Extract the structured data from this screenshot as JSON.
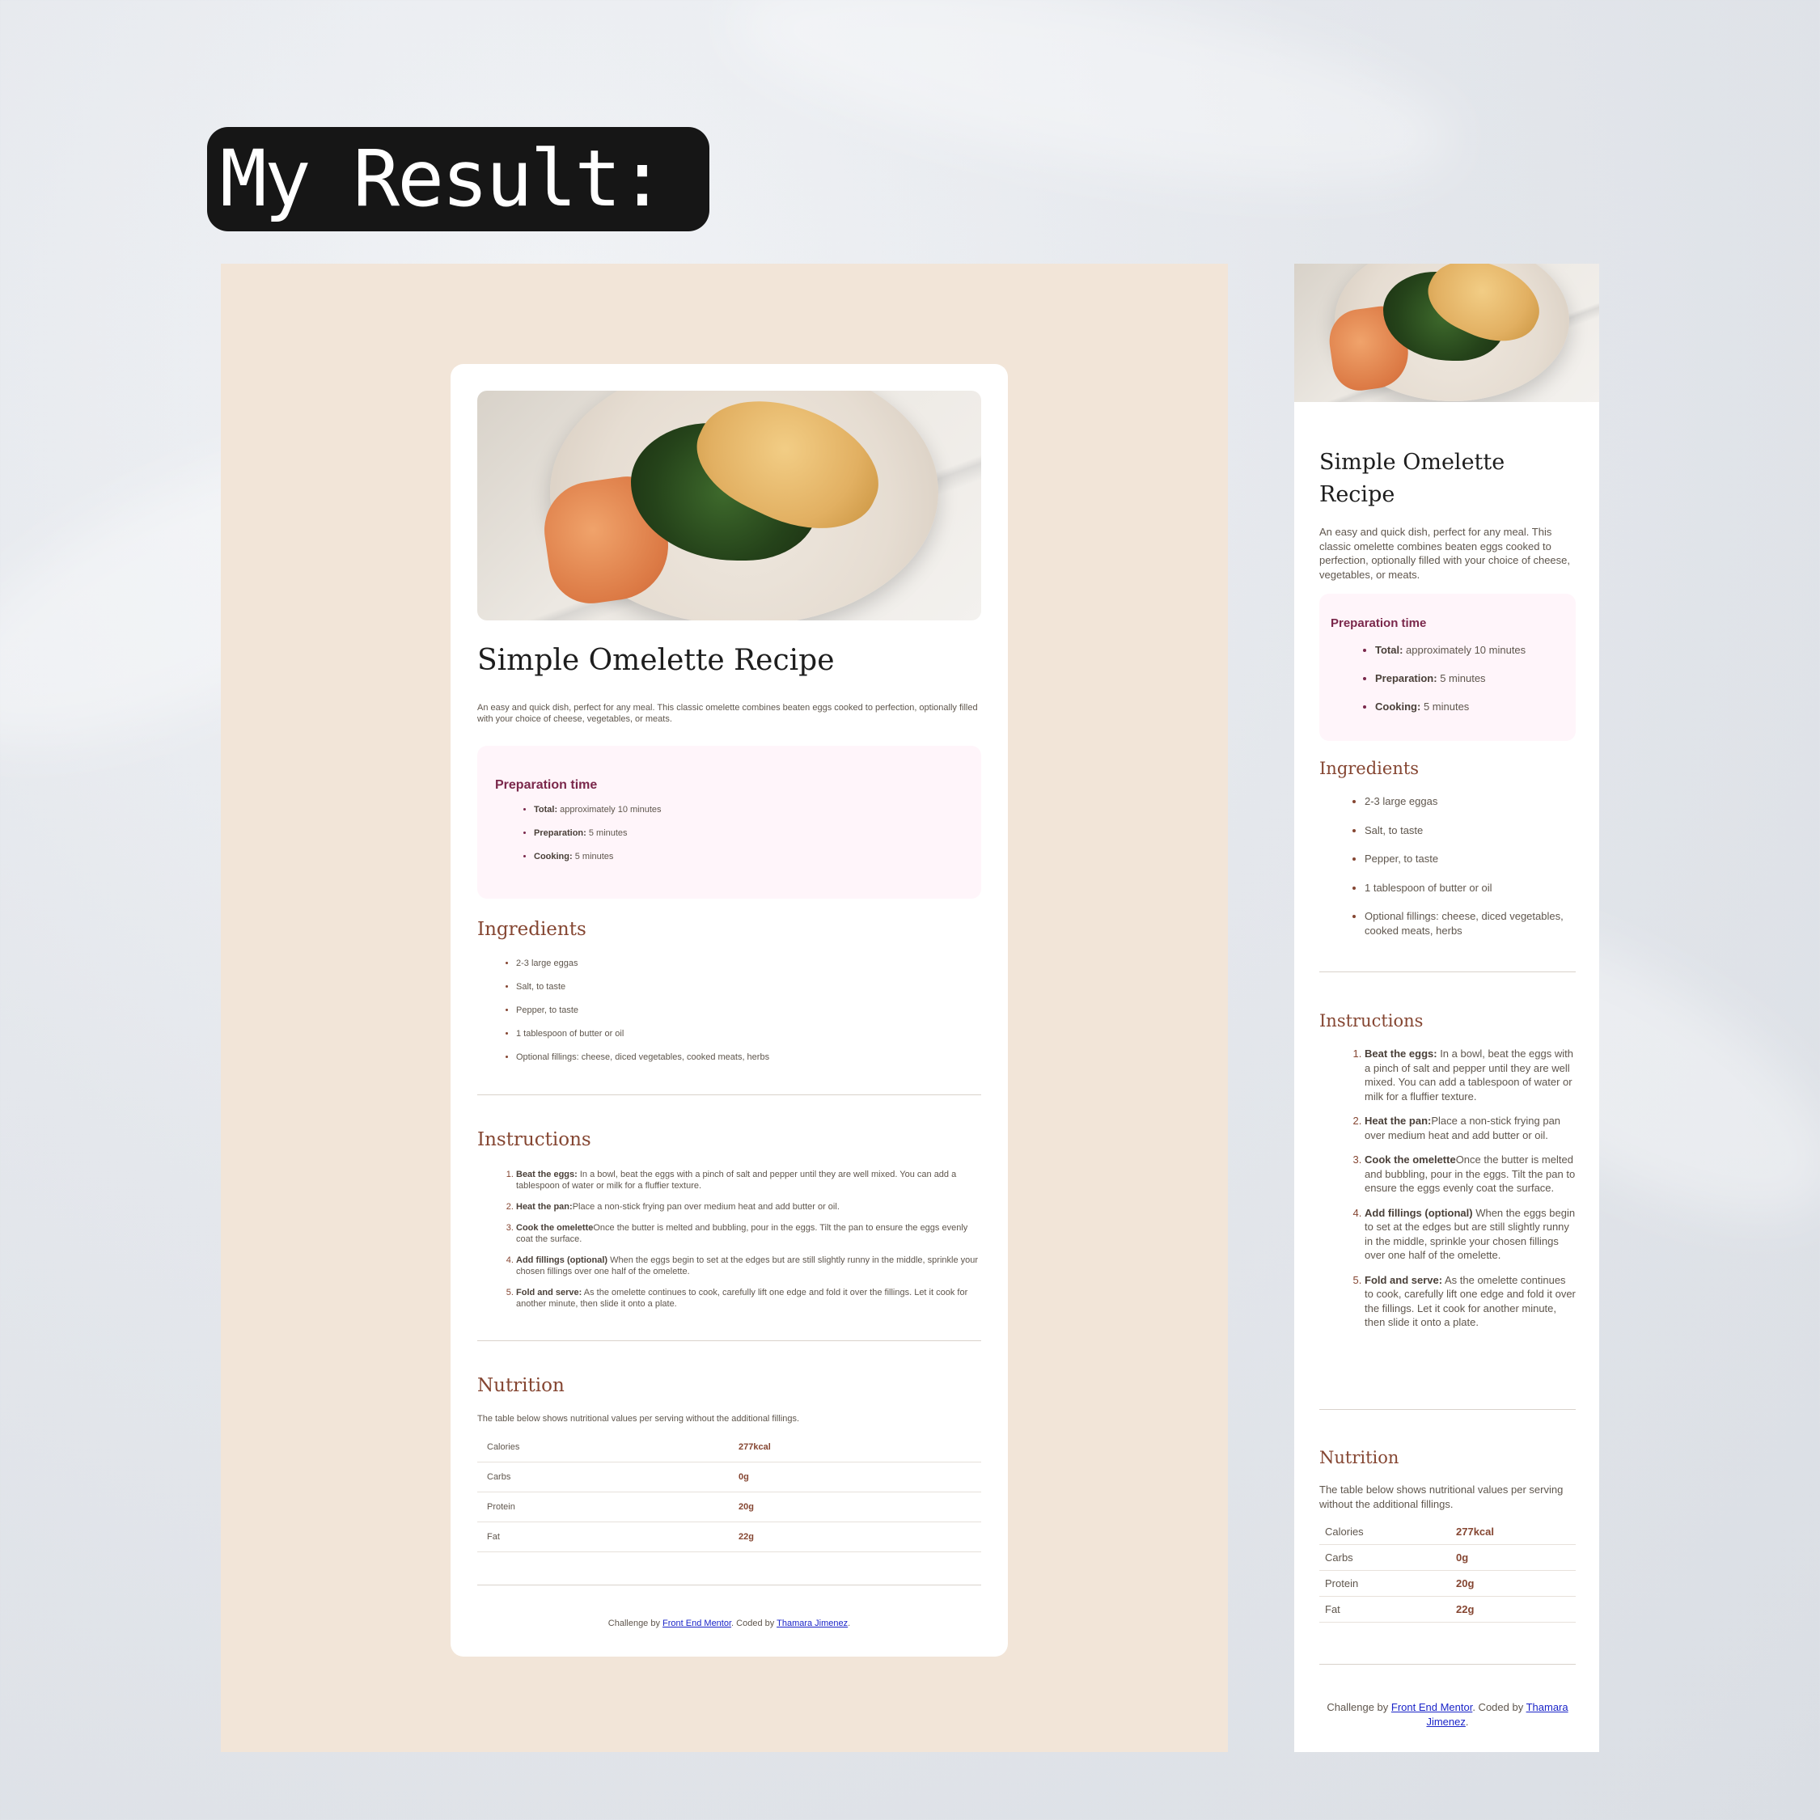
{
  "badge": "My Result:",
  "recipe": {
    "title": "Simple Omelette Recipe",
    "intro": "An easy and quick dish, perfect for any meal. This classic omelette combines beaten eggs cooked to perfection, optionally filled with your choice of cheese, vegetables, or meats.",
    "prep": {
      "heading": "Preparation time",
      "items": [
        {
          "label": "Total:",
          "value": " approximately 10 minutes"
        },
        {
          "label": "Preparation:",
          "value": " 5 minutes"
        },
        {
          "label": "Cooking:",
          "value": " 5 minutes"
        }
      ]
    },
    "ingredients": {
      "heading": "Ingredients",
      "items": [
        "2-3 large eggas",
        "Salt, to taste",
        "Pepper, to taste",
        "1 tablespoon of butter or oil",
        "Optional fillings: cheese, diced vegetables, cooked meats, herbs"
      ]
    },
    "instructions": {
      "heading": "Instructions",
      "steps": [
        {
          "label": "Beat the eggs:",
          "text": " In a bowl, beat the eggs with a pinch of salt and pepper until they are well mixed. You can add a tablespoon of water or milk for a fluffier texture."
        },
        {
          "label": "Heat the pan:",
          "text": "Place a non-stick frying pan over medium heat and add butter or oil."
        },
        {
          "label": "Cook the omelette",
          "text": "Once the butter is melted and bubbling, pour in the eggs. Tilt the pan to ensure the eggs evenly coat the surface."
        },
        {
          "label": "Add fillings (optional)",
          "text": " When the eggs begin to set at the edges but are still slightly runny in the middle, sprinkle your chosen fillings over one half of the omelette."
        },
        {
          "label": "Fold and serve:",
          "text": " As the omelette continues to cook, carefully lift one edge and fold it over the fillings. Let it cook for another minute, then slide it onto a plate."
        }
      ]
    },
    "nutrition": {
      "heading": "Nutrition",
      "text": "The table below shows nutritional values per serving without the additional fillings.",
      "rows": [
        {
          "name": "Calories",
          "value": "277kcal"
        },
        {
          "name": "Carbs",
          "value": "0g"
        },
        {
          "name": "Protein",
          "value": "20g"
        },
        {
          "name": "Fat",
          "value": "22g"
        }
      ]
    },
    "footer": {
      "prefix": "Challenge by ",
      "link1": "Front End Mentor",
      "middle": ". Coded by ",
      "link2": "Thamara Jimenez",
      "suffix": "."
    }
  },
  "colors": {
    "desktop_bg": "#f2e5d8",
    "accent_brown": "#854632",
    "prep_accent": "#7a284b",
    "prep_bg": "#fff5fa",
    "link": "#1a24c8"
  }
}
